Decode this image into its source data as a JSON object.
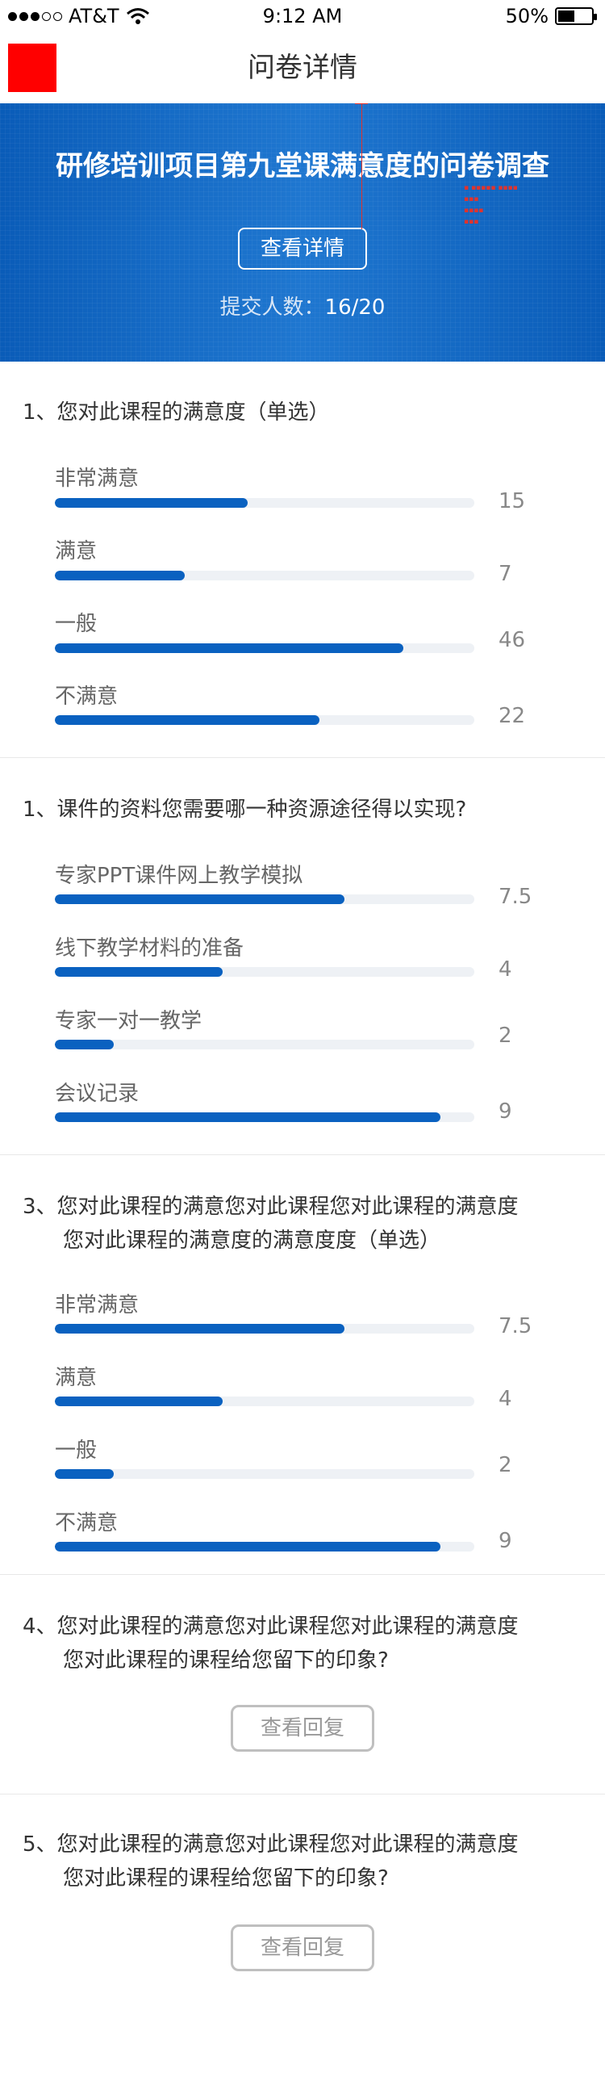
{
  "status_bar": {
    "carrier": "AT&T",
    "time": "9:12 AM",
    "battery": "50%",
    "battery_level": 0.5
  },
  "nav": {
    "title": "问卷详情"
  },
  "banner": {
    "title": "研修培训项目第九堂课满意度的问卷调查",
    "detail_button": "查看详情",
    "submit_label": "提交人数：",
    "submit_count": "16/20"
  },
  "questions": [
    {
      "line1": "1、您对此课程的满意度（单选）",
      "line2": "",
      "options": [
        {
          "label": "非常满意",
          "value": "15",
          "fraction": 0.46
        },
        {
          "label": "满意",
          "value": "7",
          "fraction": 0.31
        },
        {
          "label": "一般",
          "value": "46",
          "fraction": 0.83
        },
        {
          "label": "不满意",
          "value": "22",
          "fraction": 0.63
        }
      ]
    },
    {
      "line1": "1、课件的资料您需要哪一种资源途径得以实现?",
      "line2": "",
      "options": [
        {
          "label": "专家PPT课件网上教学模拟",
          "value": "7.5",
          "fraction": 0.69
        },
        {
          "label": "线下教学材料的准备",
          "value": "4",
          "fraction": 0.4
        },
        {
          "label": "专家一对一教学",
          "value": "2",
          "fraction": 0.14
        },
        {
          "label": "会议记录",
          "value": "9",
          "fraction": 0.92
        }
      ]
    },
    {
      "line1": "3、您对此课程的满意您对此课程您对此课程的满意度",
      "line2": "您对此课程的满意度的满意度度（单选）",
      "options": [
        {
          "label": "非常满意",
          "value": "7.5",
          "fraction": 0.69
        },
        {
          "label": "满意",
          "value": "4",
          "fraction": 0.4
        },
        {
          "label": "一般",
          "value": "2",
          "fraction": 0.14
        },
        {
          "label": "不满意",
          "value": "9",
          "fraction": 0.92
        }
      ]
    },
    {
      "line1": "4、您对此课程的满意您对此课程您对此课程的满意度",
      "line2": "您对此课程的课程给您留下的印象?",
      "button": "查看回复"
    },
    {
      "line1": "5、您对此课程的满意您对此课程您对此课程的满意度",
      "line2": "您对此课程的课程给您留下的印象?",
      "button": "查看回复"
    }
  ]
}
